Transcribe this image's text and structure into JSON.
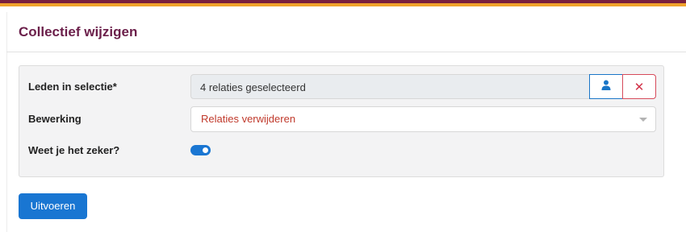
{
  "colors": {
    "brand_stripe_primary": "#7a1f3d",
    "brand_stripe_secondary": "#f0a22b",
    "title_color": "#6b1f4a",
    "accent": "#1976d2",
    "danger": "#d2334a"
  },
  "header": {
    "title": "Collectief wijzigen"
  },
  "form": {
    "members_label": "Leden in selectie*",
    "members_value": "4 relaties geselecteerd",
    "person_icon": "person-icon",
    "clear_icon": "close-icon",
    "clear_symbol": "✕",
    "operation_label": "Bewerking",
    "operation_value": "Relaties verwijderen",
    "confirm_label": "Weet je het zeker?",
    "confirm_checked": true
  },
  "actions": {
    "submit_label": "Uitvoeren"
  }
}
